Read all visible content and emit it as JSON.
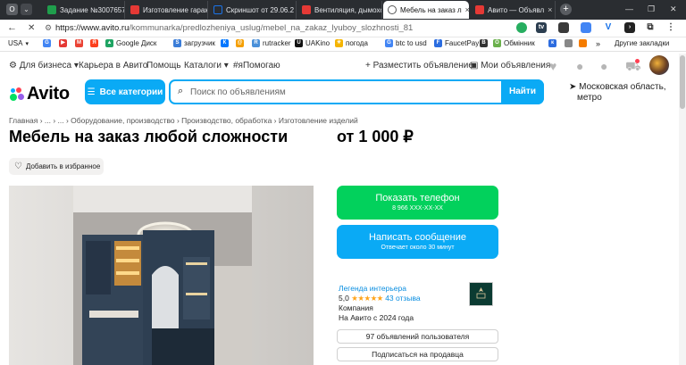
{
  "browser": {
    "tabs": [
      {
        "label": "Задание №3007657",
        "active": false,
        "icon_color": "#1f9e4c"
      },
      {
        "label": "Изготовление гараж",
        "active": false,
        "icon_color": "#e53935"
      },
      {
        "label": "Скриншот от 29.06.2",
        "active": false,
        "icon_color": "#1a73e8"
      },
      {
        "label": "Вентиляция, дымохо",
        "active": false,
        "icon_color": "#e53935"
      },
      {
        "label": "Мебель на заказ л",
        "active": true,
        "icon_color": "#666666"
      },
      {
        "label": "Авито — Объявл",
        "active": false,
        "icon_color": "#e53935"
      }
    ],
    "tab_close": "×",
    "new_tab": "+",
    "opera_icon": "O",
    "url_host": "https://www.avito.ru",
    "url_path": "/kommunarka/predlozheniya_uslug/mebel_na_zakaz_lyuboy_slozhnosti_818537...",
    "bookmarks": [
      {
        "label": "USA",
        "icon": "",
        "color": ""
      },
      {
        "label": "",
        "icon": "G",
        "color": "#4285f4"
      },
      {
        "label": "",
        "icon": "▶",
        "color": "#e53935"
      },
      {
        "label": "",
        "icon": "M",
        "color": "#ea4335"
      },
      {
        "label": "",
        "icon": "Я",
        "color": "#fc3f1d"
      },
      {
        "label": "Google Диск",
        "icon": "▲",
        "color": "#1fa463"
      },
      {
        "label": "загрузчик",
        "icon": "S",
        "color": "#3b7dd8"
      },
      {
        "label": "",
        "icon": "К",
        "color": "#0077ff"
      },
      {
        "label": "",
        "icon": "@",
        "color": "#f59f00"
      },
      {
        "label": "rutracker",
        "icon": "R",
        "color": "#4a90d9"
      },
      {
        "label": "UAKino",
        "icon": "U",
        "color": "#111111"
      },
      {
        "label": "погода",
        "icon": "☀",
        "color": "#f5b400"
      },
      {
        "label": "btc to usd",
        "icon": "G",
        "color": "#4285f4"
      },
      {
        "label": "FaucetPay",
        "icon": "F",
        "color": "#2b6de0"
      },
      {
        "label": "",
        "icon": "B",
        "color": "#333333"
      },
      {
        "label": "Обмінник",
        "icon": "О",
        "color": "#6ab04c"
      },
      {
        "label": "",
        "icon": "к",
        "color": "#2d6cdf"
      },
      {
        "label": "Другие закладки",
        "icon": "»",
        "color": ""
      }
    ]
  },
  "topnav": {
    "business": "Для бизнеса",
    "career": "Карьера в Авито",
    "help": "Помощь",
    "catalogs": "Каталоги",
    "hashtag": "#яПомогаю",
    "post_ad": "Разместить объявление",
    "my_ads": "Мои объявления"
  },
  "header": {
    "logo": "Avito",
    "categories_button": "Все категории",
    "search_placeholder": "Поиск по объявлениям",
    "search_button": "Найти",
    "location_line1": "Московская область,",
    "location_line2": "метро"
  },
  "listing": {
    "breadcrumb": "Главная › ... › ... › Оборудование, производство › Производство, обработка › Изготовление изделий",
    "title": "Мебель на заказ любой сложности",
    "price": "от 1 000 ₽",
    "favorite_button": "Добавить в избранное",
    "show_phone": "Показать телефон",
    "phone_masked": "8 966 XXX-XX-XX",
    "write_message": "Написать сообщение",
    "reply_time": "Отвечает около 30 минут"
  },
  "seller": {
    "name": "Легенда интерьера",
    "rating": "5,0",
    "stars": "★★★★★",
    "reviews": "43 отзыва",
    "type": "Компания",
    "since": "На Авито с 2024 года",
    "user_ads": "97 объявлений пользователя",
    "subscribe": "Подписаться на продавца"
  },
  "colors": {
    "avito_blue": "#0aaaf5",
    "avito_green": "#02d15c",
    "link_blue": "#0a8ee0"
  }
}
